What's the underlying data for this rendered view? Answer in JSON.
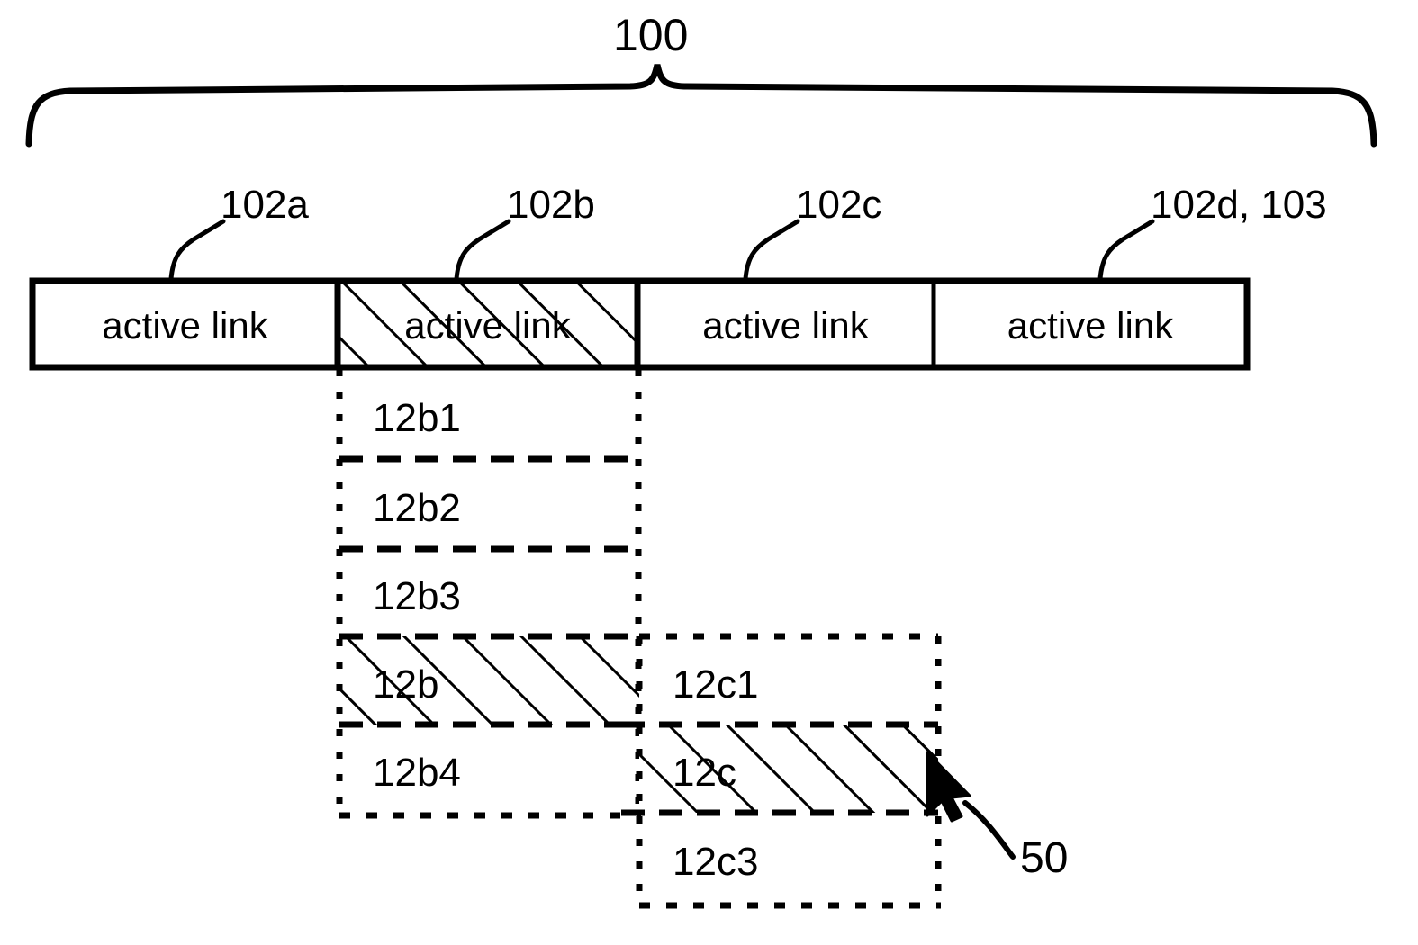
{
  "figure": {
    "title_ref": "100",
    "brace": {
      "label": "100"
    },
    "pointer_ref": "50"
  },
  "link_bar": {
    "segments": [
      {
        "ref": "102a",
        "label": "active link",
        "hatched": false
      },
      {
        "ref": "102b",
        "label": "active link",
        "hatched": true
      },
      {
        "ref": "102c",
        "label": "active link",
        "hatched": false
      },
      {
        "ref": "102d, 103",
        "label": "active link",
        "hatched": false
      }
    ]
  },
  "left_grid": {
    "rows": [
      {
        "label": "12b1",
        "hatched": false
      },
      {
        "label": "12b2",
        "hatched": false
      },
      {
        "label": "12b3",
        "hatched": false
      },
      {
        "label": "12b",
        "hatched": true
      },
      {
        "label": "12b4",
        "hatched": false
      }
    ]
  },
  "right_grid": {
    "rows": [
      {
        "label": "12c1",
        "hatched": false
      },
      {
        "label": "12c",
        "hatched": true
      },
      {
        "label": "12c3",
        "hatched": false
      }
    ]
  }
}
